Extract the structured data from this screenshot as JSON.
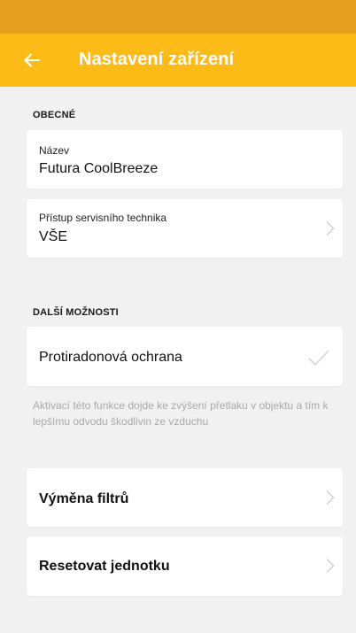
{
  "colors": {
    "status_bar": "#e5a020",
    "app_bar": "#fdbb18",
    "background": "#f1f1f2"
  },
  "header": {
    "back_icon": "arrow-left-icon",
    "title": "Nastavení zařízení"
  },
  "general": {
    "section_title": "OBECNÉ",
    "name": {
      "label": "Název",
      "value": "Futura CoolBreeze"
    },
    "technician_access": {
      "label": "Přístup servisního technika",
      "value": "VŠE",
      "icon": "chevron-right-icon"
    }
  },
  "more_options": {
    "section_title": "DALŠÍ MOŽNOSTI",
    "radon_protection": {
      "label": "Protiradonová ochrana",
      "icon": "checkmark-icon"
    },
    "hint": "Aktivací této funkce dojde ke zvýšení přetlaku v objektu a tím k lepšímu odvodu škodlivin ze vzduchu"
  },
  "actions": {
    "filter_change": {
      "label": "Výměna filtrů",
      "icon": "chevron-right-icon"
    },
    "reset_unit": {
      "label": "Resetovat jednotku",
      "icon": "chevron-right-icon"
    }
  }
}
